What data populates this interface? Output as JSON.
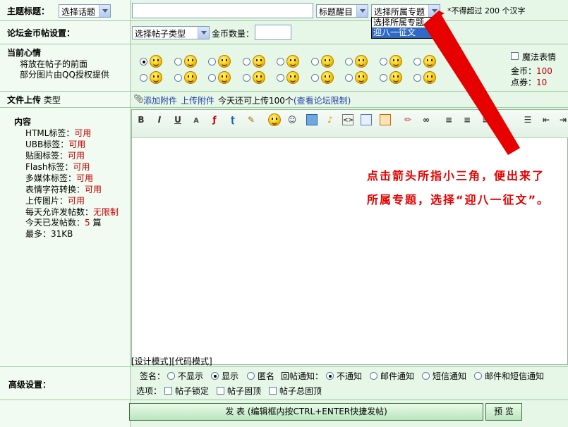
{
  "title_row": {
    "label": "主题标题：",
    "topic_select": "选择话题",
    "title_style_select": "标题醒目",
    "special_select": "选择所属专题",
    "dropdown_options": [
      "选择所属专题",
      "迎八一征文"
    ],
    "limit_prefix": "*不得超过",
    "limit_value": "200",
    "limit_suffix": "个汉字"
  },
  "coin_row": {
    "label": "论坛金币帖设置：",
    "type_select": "选择帖子类型",
    "coin_label": "金币数量："
  },
  "mood_row": {
    "label": "当前心情",
    "desc1": "将放在帖子的前面",
    "desc2": "部分图片由QQ授权提供",
    "magic_label": "魔法表情",
    "coin_text": "金币：",
    "coin_value": "100",
    "points_text": "点券：",
    "points_value": "10"
  },
  "upload_row": {
    "label": "文件上传",
    "type_label": "类型",
    "add_attachment": "添加附件",
    "upload_attachment": "上传附件",
    "remaining": "今天还可上传100个",
    "limit_link": "(查看论坛限制)"
  },
  "content": {
    "label": "内容",
    "tags": [
      {
        "name": "HTML标签：",
        "value": "可用"
      },
      {
        "name": "UBB标签：",
        "value": "可用"
      },
      {
        "name": "贴图标签：",
        "value": "可用"
      },
      {
        "name": "Flash标签：",
        "value": "可用"
      },
      {
        "name": "多媒体标签：",
        "value": "可用"
      },
      {
        "name": "表情字符转换：",
        "value": "可用"
      },
      {
        "name": "上传图片：",
        "value": "可用"
      },
      {
        "name": "每天允许发帖数：",
        "value": "无限制"
      }
    ],
    "today_posts_label": "今天已发帖数：",
    "today_posts_value": "5",
    "today_posts_unit": "篇",
    "max_size": "最多：31KB",
    "design_mode": "[设计模式]",
    "code_mode": "[代码模式]",
    "toolbar": [
      "B",
      "I",
      "U"
    ]
  },
  "annotation": {
    "line1": "点击箭头所指小三角，便出来了",
    "line2": "所属专题，选择“迎八一征文”。"
  },
  "advanced": {
    "label": "高级设置：",
    "sign_label": "签名：",
    "sign_options": [
      "不显示",
      "显示",
      "匿名"
    ],
    "notify_label": "回帖通知：",
    "notify_options": [
      "不通知",
      "邮件通知",
      "短信通知",
      "邮件和短信通知"
    ],
    "options_label": "选项：",
    "checkboxes": [
      "帖子锁定",
      "帖子固顶",
      "帖子总固顶"
    ]
  },
  "buttons": {
    "submit": "发 表 (编辑框内按CTRL+ENTER快捷发帖)",
    "preview": "预 览"
  },
  "colors": {
    "annotation_red": "#e60000",
    "value_red": "#c00000",
    "border_green": "#9ec9a2"
  }
}
